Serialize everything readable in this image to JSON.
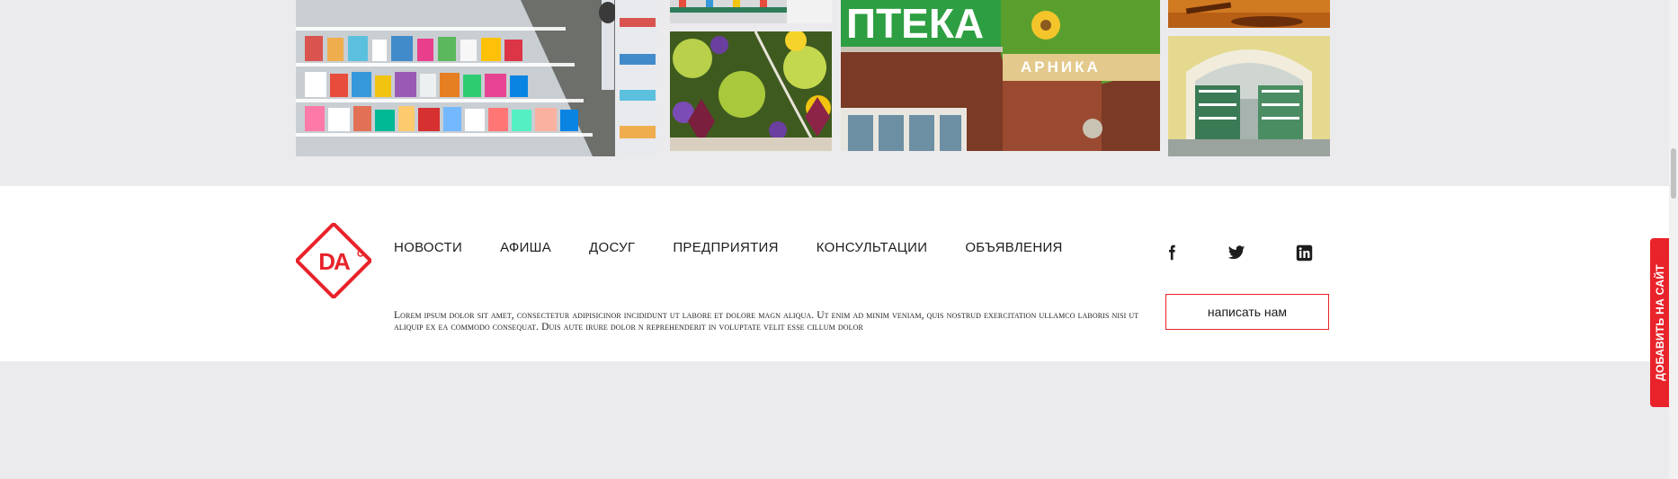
{
  "gallery": {
    "images": [
      "pharmacy-shelves",
      "pharmacy-interior",
      "flower-bouquet",
      "pharmacy-storefront",
      "gavel",
      "pharmacy-hall"
    ],
    "storefront_sign": "ПТЕКА",
    "storefront_brand": "АРНИКА"
  },
  "footer": {
    "logo_text": "DA",
    "nav": [
      "НОВОСТИ",
      "АФИША",
      "ДОСУГ",
      "ПРЕДПРИЯТИЯ",
      "КОНСУЛЬТАЦИИ",
      "ОБЪЯВЛЕНИЯ"
    ],
    "description": "Lorem ipsum dolor sit amet, consectetur adipisicinor incididunt ut labore et dolore magn aliqua. Ut enim ad minim veniam, quis nostrud exercitation ullamco laboris nisi ut aliquip ex ea commodo consequat. Duis aute irure dolor n reprehenderit in voluptate velit esse cillum dolor",
    "social": [
      "facebook-icon",
      "twitter-icon",
      "linkedin-icon"
    ],
    "contact_label": "написать нам"
  },
  "side_tab": {
    "label": "ДОБАВИТЬ НА САЙТ"
  },
  "colors": {
    "accent": "#e8232a",
    "background": "#ebebed",
    "footer_bg": "#ffffff"
  }
}
